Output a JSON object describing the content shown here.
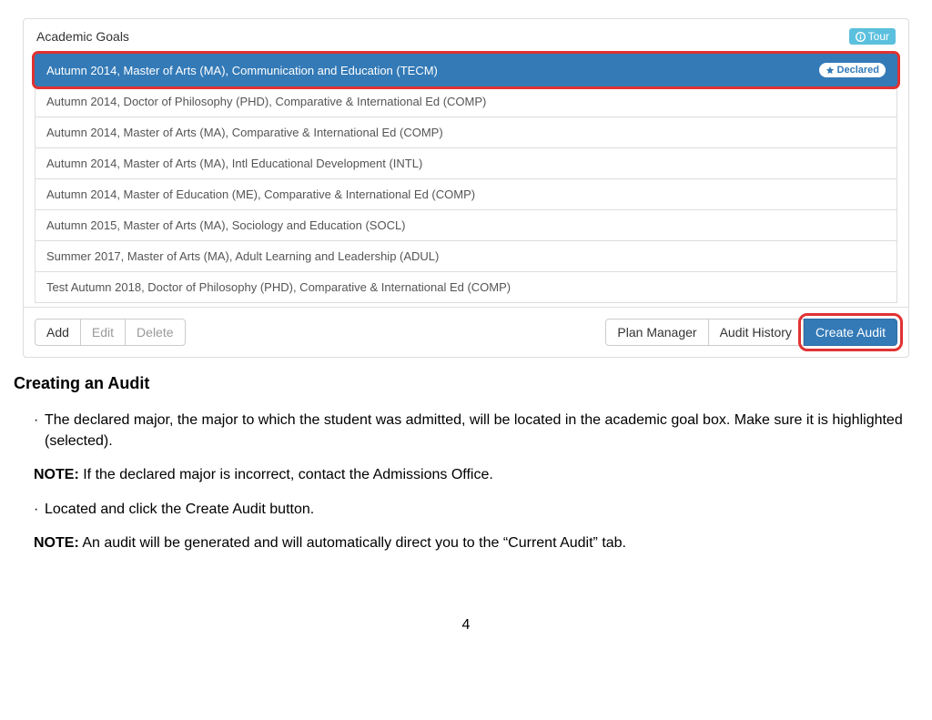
{
  "panel": {
    "title": "Academic Goals",
    "tour_label": "Tour",
    "declared_label": "Declared",
    "goals": [
      {
        "label": "Autumn 2014, Master of Arts (MA), Communication and Education (TECM)",
        "selected": true,
        "declared": true
      },
      {
        "label": "Autumn 2014, Doctor of Philosophy (PHD), Comparative & International Ed (COMP)",
        "selected": false,
        "declared": false
      },
      {
        "label": "Autumn 2014, Master of Arts (MA), Comparative & International Ed (COMP)",
        "selected": false,
        "declared": false
      },
      {
        "label": "Autumn 2014, Master of Arts (MA), Intl Educational Development (INTL)",
        "selected": false,
        "declared": false
      },
      {
        "label": "Autumn 2014, Master of Education (ME), Comparative & International Ed (COMP)",
        "selected": false,
        "declared": false
      },
      {
        "label": "Autumn 2015, Master of Arts (MA), Sociology and Education (SOCL)",
        "selected": false,
        "declared": false
      },
      {
        "label": "Summer 2017, Master of Arts (MA), Adult Learning and Leadership (ADUL)",
        "selected": false,
        "declared": false
      },
      {
        "label": "Test Autumn 2018, Doctor of Philosophy (PHD), Comparative & International Ed (COMP)",
        "selected": false,
        "declared": false
      }
    ],
    "footer_left": {
      "add": "Add",
      "edit": "Edit",
      "delete": "Delete"
    },
    "footer_right": {
      "plan_manager": "Plan Manager",
      "audit_history": "Audit History",
      "create_audit": "Create Audit"
    }
  },
  "doc": {
    "heading": "Creating an Audit",
    "bullet1": "The declared major, the major to which the student was admitted, will be located in the academic goal box. Make sure it is  highlighted (selected).",
    "note1_label": "NOTE:",
    "note1_text": " If the declared major is incorrect, contact the Admissions Office.",
    "bullet2": "Located and click the Create Audit button.",
    "note2_label": "NOTE:",
    "note2_text": " An audit will be generated and will automatically direct you to the “Current Audit” tab.",
    "page_number": "4"
  }
}
